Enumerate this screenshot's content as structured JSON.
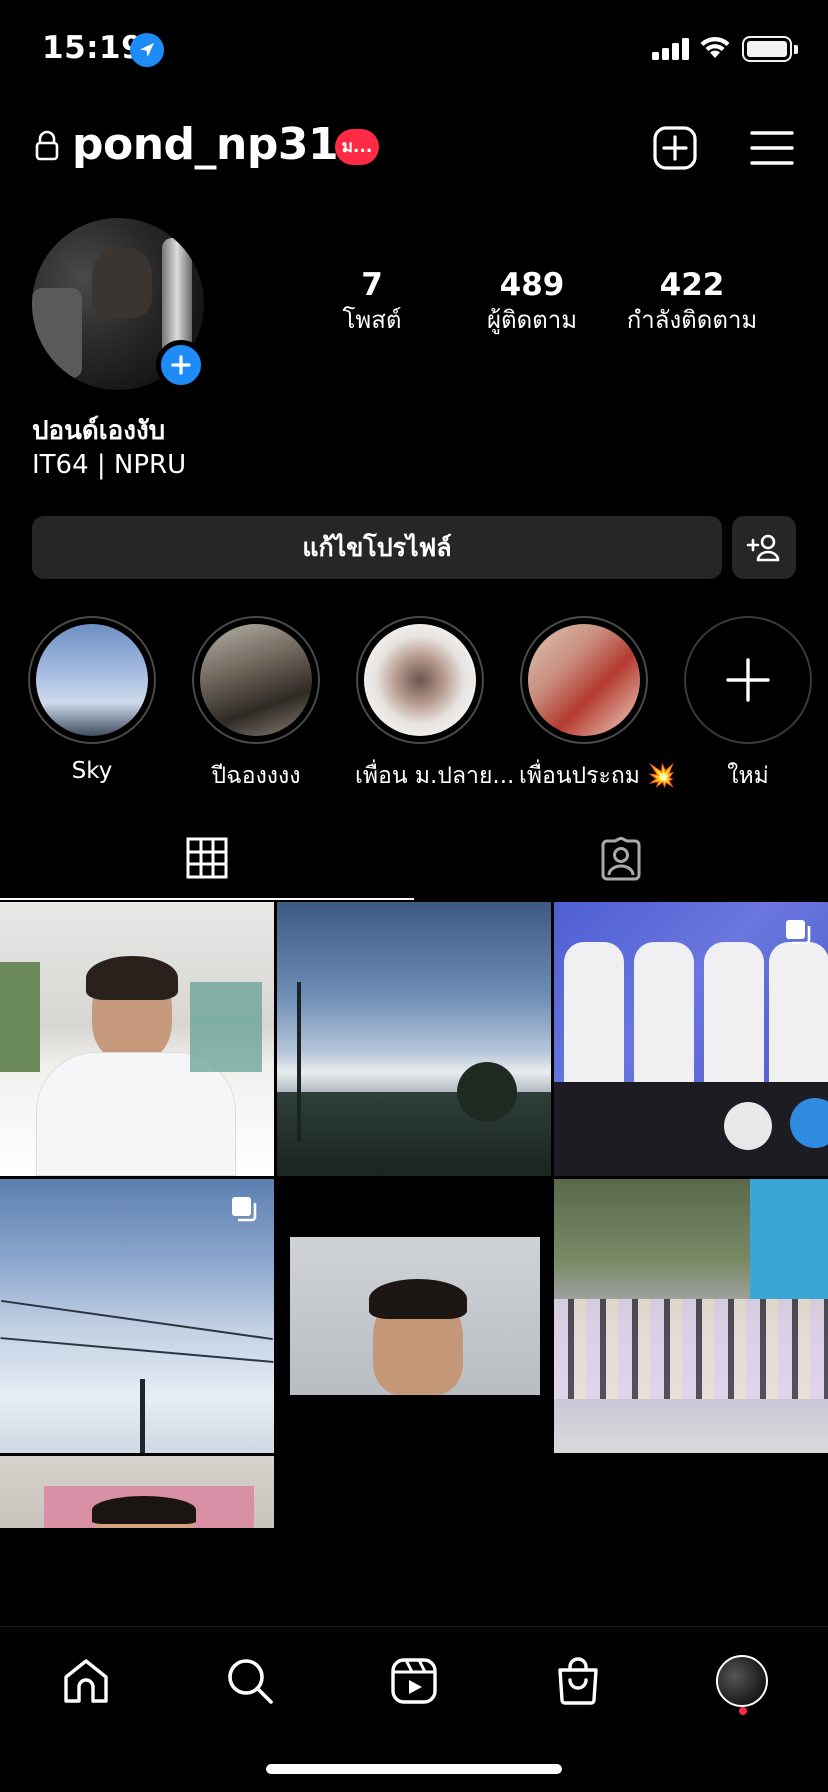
{
  "status_bar": {
    "time": "15:19"
  },
  "header": {
    "username": "pond_np31",
    "badge_text": "ม...",
    "icons": [
      "lock-icon",
      "plus-square-icon",
      "hamburger-menu-icon"
    ]
  },
  "profile": {
    "stats": [
      {
        "value": "7",
        "label": "โพสต์"
      },
      {
        "value": "489",
        "label": "ผู้ติดตาม"
      },
      {
        "value": "422",
        "label": "กำลังติดตาม"
      }
    ],
    "display_name": "ปอนด์เองงับ",
    "bio": "IT64 | NPRU",
    "edit_profile_label": "แก้ไขโปรไฟล์"
  },
  "highlights": [
    {
      "label": "Sky"
    },
    {
      "label": "ปีฉองงงง"
    },
    {
      "label": "เพื่อน ม.ปลาย..."
    },
    {
      "label": "เพื่อนประถม 💥"
    },
    {
      "label": "ใหม่"
    }
  ],
  "tabs": [
    {
      "name": "posts-grid",
      "icon": "grid-icon",
      "active": true
    },
    {
      "name": "tagged",
      "icon": "tagged-person-icon",
      "active": false
    }
  ],
  "posts": [
    {
      "description": "photo",
      "multi": false
    },
    {
      "description": "photo",
      "multi": false
    },
    {
      "description": "photo",
      "multi": true
    },
    {
      "description": "photo",
      "multi": true
    },
    {
      "description": "photo",
      "multi": false
    },
    {
      "description": "photo",
      "multi": false
    },
    {
      "description": "photo",
      "multi": false
    }
  ],
  "bottom_nav": [
    "home-icon",
    "search-icon",
    "reels-icon",
    "shop-icon",
    "profile-avatar"
  ],
  "colors": {
    "accent": "#1d8cf8",
    "notification": "#ff2b45",
    "button_bg": "#262626"
  }
}
